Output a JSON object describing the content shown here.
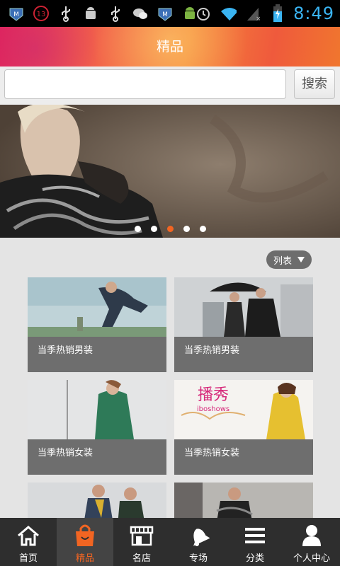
{
  "status_bar": {
    "notification_count": "13",
    "clock": "8:49",
    "icons": [
      "app-m-icon",
      "notification-count-icon",
      "usb-icon",
      "android-debug-icon",
      "usb-icon",
      "wechat-icon",
      "app-m-icon",
      "android-icon",
      "alarm-icon",
      "wifi-icon",
      "battery-charging-icon"
    ]
  },
  "header": {
    "title": "精品"
  },
  "search": {
    "placeholder": "",
    "value": "",
    "button_label": "搜索"
  },
  "banner": {
    "slide_count": 5,
    "active_index": 2
  },
  "view_toggle": {
    "label": "列表",
    "icon": "triangle-down-icon"
  },
  "products": [
    {
      "label": "当季热销男装"
    },
    {
      "label": "当季热销男装"
    },
    {
      "label": "当季热销女装"
    },
    {
      "label": "当季热销女装",
      "image_text": "播秀",
      "image_subtext": "iboshows"
    },
    {
      "label": ""
    },
    {
      "label": ""
    }
  ],
  "tabbar": {
    "items": [
      {
        "label": "首页",
        "icon": "home-icon"
      },
      {
        "label": "精品",
        "icon": "shopping-bag-icon",
        "active": true
      },
      {
        "label": "名店",
        "icon": "storefront-icon"
      },
      {
        "label": "专场",
        "icon": "bell-icon"
      },
      {
        "label": "分类",
        "icon": "menu-icon"
      },
      {
        "label": "个人中心",
        "icon": "user-icon"
      }
    ]
  },
  "colors": {
    "accent": "#f26522",
    "clock": "#3ab4f2",
    "tabbar_bg": "#2e2e2e",
    "card_bg": "#6e6e6e"
  }
}
